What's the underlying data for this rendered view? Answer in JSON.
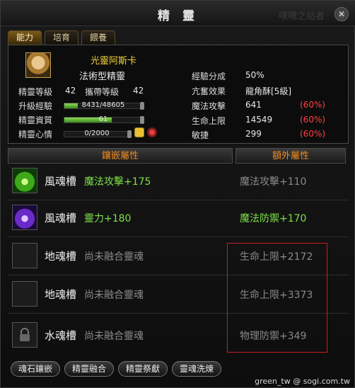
{
  "window": {
    "title": "精 靈",
    "ghost_text": "嘿嘿之站者",
    "close_icon": "close-icon"
  },
  "tabs": [
    {
      "label": "能力",
      "active": true
    },
    {
      "label": "培育",
      "active": false
    },
    {
      "label": "餵養",
      "active": false
    }
  ],
  "spirit": {
    "name": "光靈阿斯卡",
    "type": "法術型精靈",
    "portrait_icon": "spirit-portrait",
    "level_label": "精靈等級",
    "level": "42",
    "carry_label": "攜帶等級",
    "carry_level": "42",
    "exp_label": "升級經驗",
    "exp_text": "8431/48605",
    "exp_ratio": 0.173,
    "aptitude_label": "精靈資質",
    "aptitude_text": "61",
    "aptitude_ratio": 0.61,
    "mood_label": "精靈心情",
    "mood_text": "0/2000",
    "mood_ratio": 0.0,
    "mood_icons": [
      "mood-face-icon",
      "feed-food-icon"
    ]
  },
  "stats_right": [
    {
      "label": "經驗分成",
      "value": "50%",
      "extra": ""
    },
    {
      "label": "亢奮效果",
      "value": "龍角酥[5級]",
      "extra": ""
    },
    {
      "label": "魔法攻擊",
      "value": "641",
      "extra": "(60%)"
    },
    {
      "label": "生命上限",
      "value": "14549",
      "extra": "(60%)"
    },
    {
      "label": "敏捷",
      "value": "299",
      "extra": "(60%)"
    }
  ],
  "section": {
    "left_header": "鑲嵌屬性",
    "right_header": "額外屬性"
  },
  "slots": [
    {
      "name": "風魂槽",
      "attr": "魔法攻擊+175",
      "attr_active": true,
      "extra": "魔法攻擊+110",
      "extra_active": false,
      "icon": "wind-soul-icon",
      "locked": false
    },
    {
      "name": "風魂槽",
      "attr": "靈力+180",
      "attr_active": true,
      "extra": "魔法防禦+170",
      "extra_active": true,
      "icon": "wind-soul-purple-icon",
      "locked": false
    },
    {
      "name": "地魂槽",
      "attr": "尚未融合靈魂",
      "attr_active": false,
      "extra": "生命上限+2172",
      "extra_active": false,
      "icon": "empty-slot-icon",
      "locked": false
    },
    {
      "name": "地魂槽",
      "attr": "尚未融合靈魂",
      "attr_active": false,
      "extra": "生命上限+3373",
      "extra_active": false,
      "icon": "empty-slot-icon",
      "locked": false
    },
    {
      "name": "水魂槽",
      "attr": "尚未融合靈魂",
      "attr_active": false,
      "extra": "物理防禦+349",
      "extra_active": false,
      "icon": "lock-icon",
      "locked": true
    }
  ],
  "buttons": [
    "魂石鑲嵌",
    "精靈融合",
    "精靈祭獻",
    "靈魂洗煉"
  ],
  "watermark": "green_tw  @ sogi.com.tw",
  "colors": {
    "accent_orange": "#f08a20",
    "name_yellow": "#f2d23a",
    "bonus_red": "#ff4040",
    "active_green": "#7ee04a",
    "inactive_grey": "#8a8a8a",
    "highlight_red": "#c82020"
  }
}
